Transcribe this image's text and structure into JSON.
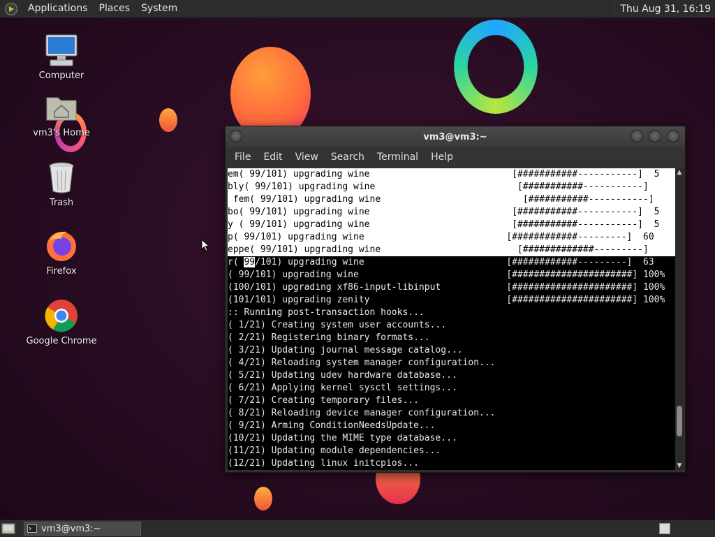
{
  "top_panel": {
    "menus": [
      "Applications",
      "Places",
      "System"
    ],
    "clock": "Thu Aug 31, 16:19"
  },
  "desktop": {
    "icons": [
      {
        "label": "Computer",
        "icon": "computer-icon"
      },
      {
        "label": "vm3's Home",
        "icon": "home-folder-icon"
      },
      {
        "label": "Trash",
        "icon": "trash-icon"
      },
      {
        "label": "Firefox",
        "icon": "firefox-icon"
      },
      {
        "label": "Google Chrome",
        "icon": "chrome-icon"
      }
    ]
  },
  "window": {
    "title": "vm3@vm3:~",
    "menu": [
      "File",
      "Edit",
      "View",
      "Search",
      "Terminal",
      "Help"
    ]
  },
  "terminal": {
    "lines": [
      {
        "text": "em( 99/101) upgrading wine",
        "bar": "[###########-----------]  5",
        "bar_col": 52,
        "hl": true
      },
      {
        "text": "bly( 99/101) upgrading wine",
        "bar": "[###########-----------]",
        "bar_col": 53,
        "hl": true
      },
      {
        "text": " fem( 99/101) upgrading wine",
        "bar": "[###########-----------]",
        "bar_col": 54,
        "hl": true
      },
      {
        "text": "bo( 99/101) upgrading wine",
        "bar": "[###########-----------]  5",
        "bar_col": 52,
        "hl": true
      },
      {
        "text": "y ( 99/101) upgrading wine",
        "bar": "[###########-----------]  5",
        "bar_col": 52,
        "hl": true
      },
      {
        "text": "p( 99/101) upgrading wine",
        "bar": "[############---------]  60",
        "bar_col": 51,
        "hl": true
      },
      {
        "text": "eppe( 99/101) upgrading wine",
        "bar": "[#############---------]",
        "bar_col": 53,
        "hl": true
      },
      {
        "text": "r( ",
        "cursor_text": "99/101) upgrading wine",
        "bar": "[############---------]  63",
        "bar_col": 51,
        "hl": false
      },
      {
        "text": "( 99/101) upgrading wine",
        "bar": "[######################] 100%",
        "bar_col": 51,
        "hl": false
      },
      {
        "text": "(100/101) upgrading xf86-input-libinput",
        "bar": "[######################] 100%",
        "bar_col": 51,
        "hl": false
      },
      {
        "text": "(101/101) upgrading zenity",
        "bar": "[######################] 100%",
        "bar_col": 51,
        "hl": false
      },
      {
        "text": ":: Running post-transaction hooks...",
        "bar": "",
        "hl": false
      },
      {
        "text": "( 1/21) Creating system user accounts...",
        "bar": "",
        "hl": false
      },
      {
        "text": "( 2/21) Registering binary formats...",
        "bar": "",
        "hl": false
      },
      {
        "text": "( 3/21) Updating journal message catalog...",
        "bar": "",
        "hl": false
      },
      {
        "text": "( 4/21) Reloading system manager configuration...",
        "bar": "",
        "hl": false
      },
      {
        "text": "( 5/21) Updating udev hardware database...",
        "bar": "",
        "hl": false
      },
      {
        "text": "( 6/21) Applying kernel sysctl settings...",
        "bar": "",
        "hl": false
      },
      {
        "text": "( 7/21) Creating temporary files...",
        "bar": "",
        "hl": false
      },
      {
        "text": "( 8/21) Reloading device manager configuration...",
        "bar": "",
        "hl": false
      },
      {
        "text": "( 9/21) Arming ConditionNeedsUpdate...",
        "bar": "",
        "hl": false
      },
      {
        "text": "(10/21) Updating the MIME type database...",
        "bar": "",
        "hl": false
      },
      {
        "text": "(11/21) Updating module dependencies...",
        "bar": "",
        "hl": false
      },
      {
        "text": "(12/21) Updating linux initcpios...",
        "bar": "",
        "hl": false
      }
    ]
  },
  "taskbar": {
    "task_label": "vm3@vm3:~"
  }
}
